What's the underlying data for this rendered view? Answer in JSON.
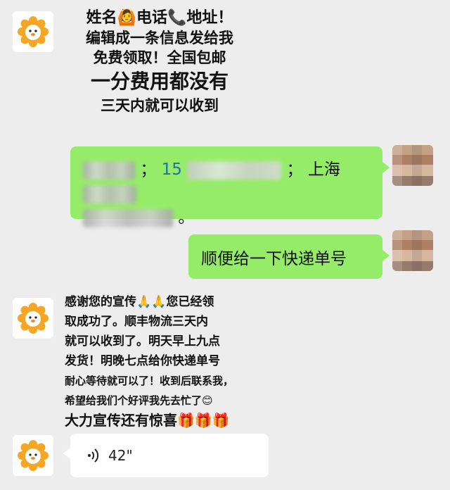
{
  "promo": {
    "line1": "姓名🙆电话📞地址！",
    "line2": "编辑成一条信息发给我",
    "line3": "免费领取！全国包邮",
    "line4": "一分费用都没有",
    "line5": "三天内就可以收到"
  },
  "user_info": {
    "sep1": "；",
    "phone_prefix": "15",
    "sep2": "；",
    "addr_prefix": "上海",
    "end": "。"
  },
  "user_request": "顺便给一下快递单号",
  "reply": {
    "line1": "感谢您的宣传🙏🙏您已经领",
    "line2": "取成功了。顺丰物流三天内",
    "line3": "就可以收到了。明天早上九点",
    "line4": "发货！明晚七点给你快递单号",
    "line5": "耐心等待就可以了！收到后联系我，",
    "line6": "希望给我们个好评我先去忙了😊",
    "line7": "大力宣传还有惊喜🎁🎁🎁"
  },
  "voice": {
    "icon": "voice-wave-icon",
    "duration": "42\""
  },
  "colors": {
    "background": "#ededed",
    "sent_bubble": "#95ec69",
    "received_bubble": "#ffffff",
    "lion": "#f5a623"
  }
}
